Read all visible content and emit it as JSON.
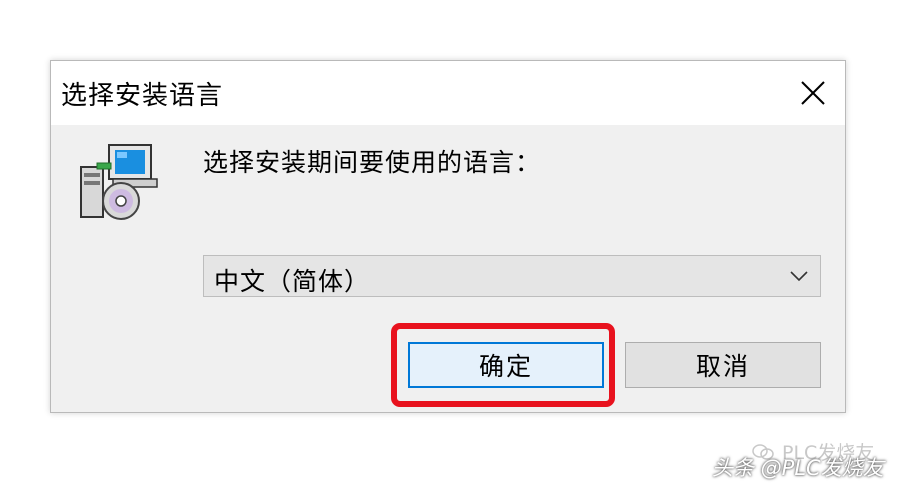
{
  "dialog": {
    "title": "选择安装语言",
    "prompt": "选择安装期间要使用的语言：",
    "language_select": {
      "selected": "中文（简体）"
    },
    "ok_label": "确定",
    "cancel_label": "取消"
  },
  "watermark": {
    "line1": "PLC发烧友",
    "line2": "头条 @PLC发烧友"
  },
  "icons": {
    "close": "close-icon",
    "installer": "installer-icon",
    "dropdown": "chevron-down-icon"
  },
  "colors": {
    "highlight": "#e8121e",
    "focus": "#0078d7",
    "dialog_bg": "#f0f0f0"
  }
}
